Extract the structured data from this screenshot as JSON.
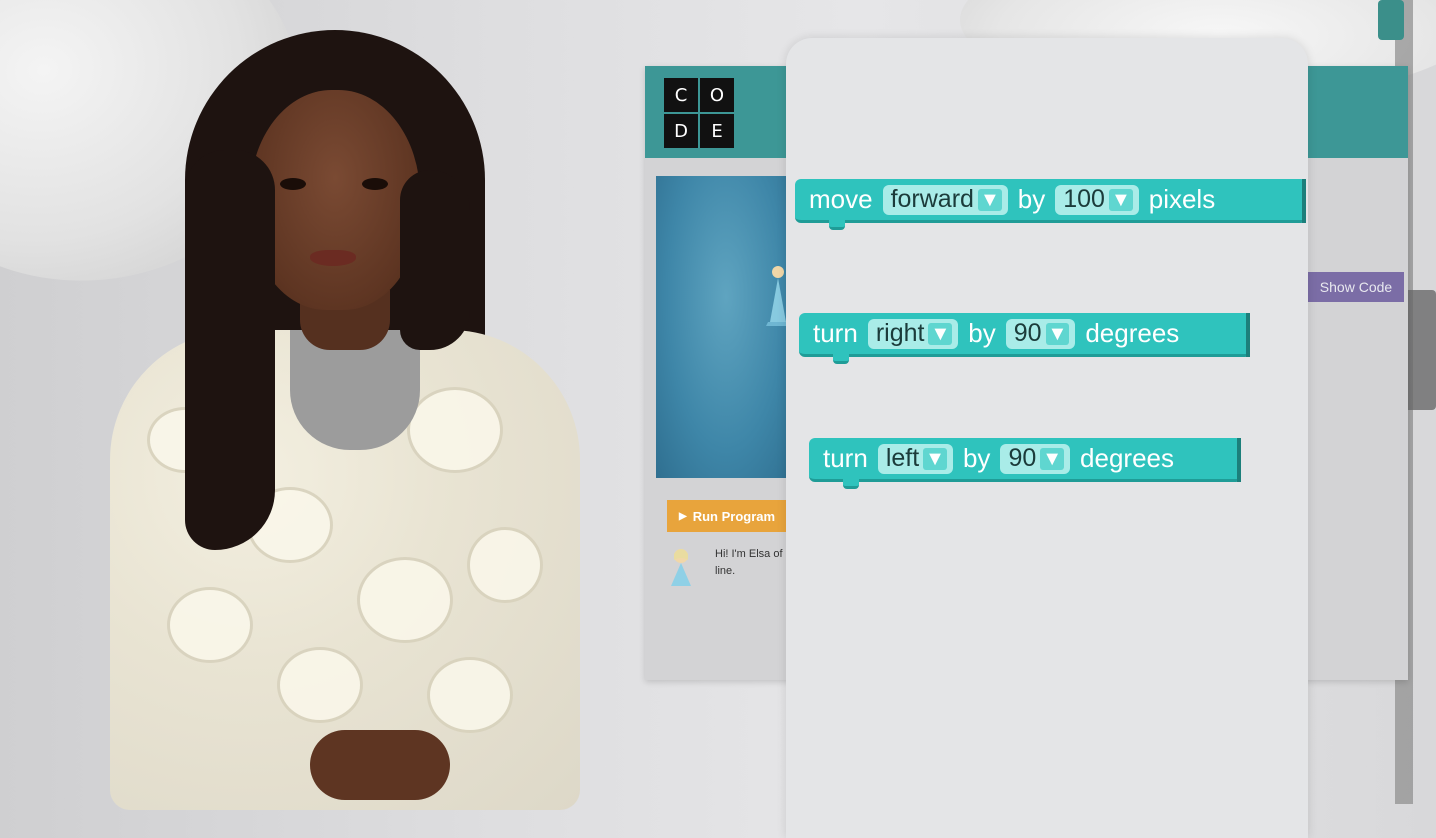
{
  "app": {
    "logo_letters": [
      "C",
      "O",
      "D",
      "E"
    ],
    "run_button": "Run Program",
    "show_code_button": "Show Code",
    "instructions": "Hi! I'm Elsa of line."
  },
  "blocks": {
    "move": {
      "verb": "move",
      "direction": "forward",
      "by": "by",
      "amount": "100",
      "unit": "pixels"
    },
    "turn_right": {
      "verb": "turn",
      "direction": "right",
      "by": "by",
      "amount": "90",
      "unit": "degrees"
    },
    "turn_left": {
      "verb": "turn",
      "direction": "left",
      "by": "by",
      "amount": "90",
      "unit": "degrees"
    }
  },
  "icons": {
    "run": "play-icon",
    "dropdown": "caret-down-icon"
  },
  "colors": {
    "header": "#3d9796",
    "block": "#2fc3bd",
    "run_button": "#e8a43c",
    "show_code": "#7b6da6"
  }
}
